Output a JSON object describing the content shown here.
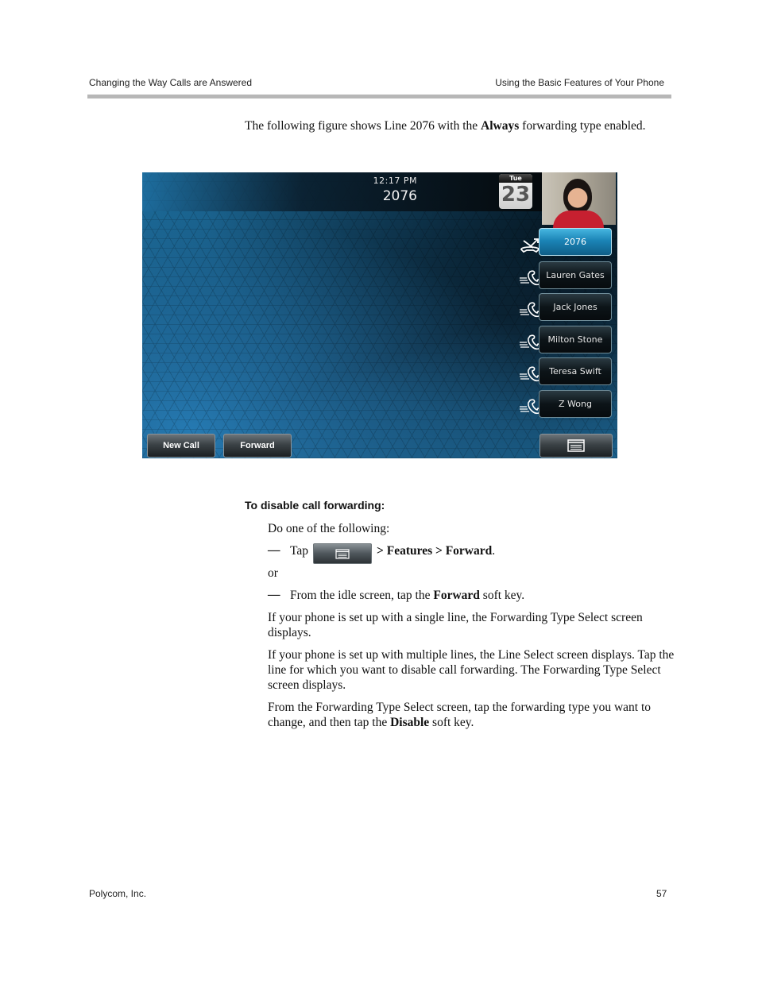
{
  "header": {
    "left": "Changing the Way Calls are Answered",
    "right": "Using the Basic Features of Your Phone"
  },
  "intro": {
    "before": "The following figure shows Line 2076 with the ",
    "bold": "Always",
    "after": " forwarding type enabled."
  },
  "phone_screen": {
    "time": "12:17 PM",
    "line_number": "2076",
    "calendar": {
      "day_of_week": "Tue",
      "day": "23"
    },
    "contact_photo": "contact-photo",
    "line_keys": [
      {
        "label": "2076",
        "state": "active",
        "icon": "forward-always-icon"
      },
      {
        "label": "Lauren Gates",
        "state": "idle",
        "icon": "handset-icon"
      },
      {
        "label": "Jack Jones",
        "state": "idle",
        "icon": "handset-icon"
      },
      {
        "label": "Milton Stone",
        "state": "idle",
        "icon": "handset-icon"
      },
      {
        "label": "Teresa Swift",
        "state": "idle",
        "icon": "handset-icon"
      },
      {
        "label": "Z Wong",
        "state": "idle",
        "icon": "handset-icon"
      }
    ],
    "soft_keys": {
      "new_call": "New Call",
      "forward": "Forward",
      "menu_icon": "menu-icon"
    },
    "colors": {
      "active_line": "#1b84b6",
      "background": "#154e72"
    }
  },
  "procedure": {
    "title": "To disable call forwarding:",
    "intro": "Do one of the following:",
    "option1": {
      "dash": "—",
      "tap": "Tap",
      "path": "> Features > Forward",
      "end": "."
    },
    "or": "or",
    "option2": {
      "dash": "—",
      "before": "From the idle screen, tap the ",
      "bold": "Forward",
      "after": " soft key."
    },
    "para1": "If your phone is set up with a single line, the Forwarding Type Select screen displays.",
    "para2": "If your phone is set up with multiple lines, the Line Select screen displays. Tap the line for which you want to disable call forwarding. The Forwarding Type Select screen displays.",
    "para3": {
      "before": "From the Forwarding Type Select screen, tap the forwarding type you want to change, and then tap the ",
      "bold": "Disable",
      "after": " soft key."
    }
  },
  "footer": {
    "company": "Polycom, Inc.",
    "page_number": "57"
  }
}
